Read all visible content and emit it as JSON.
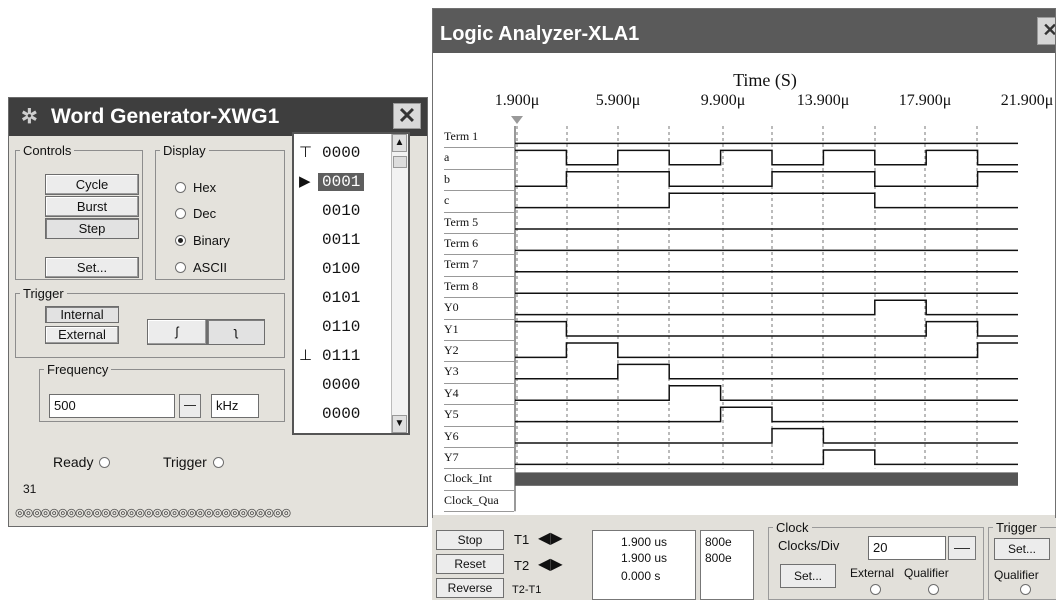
{
  "word_generator": {
    "title": "Word Generator-XWG1",
    "close": "✕",
    "controls": {
      "legend": "Controls",
      "cycle": "Cycle",
      "burst": "Burst",
      "step": "Step",
      "set": "Set..."
    },
    "display": {
      "legend": "Display",
      "options": [
        "Hex",
        "Dec",
        "Binary",
        "ASCII"
      ],
      "selected": "Binary"
    },
    "trigger": {
      "legend": "Trigger",
      "internal": "Internal",
      "external": "External",
      "rising_edge": "ʃ",
      "falling_edge": "ʅ"
    },
    "frequency": {
      "legend": "Frequency",
      "value": "500",
      "unit": "kHz"
    },
    "status": {
      "ready": "Ready",
      "trigger": "Trigger"
    },
    "counter": "31",
    "words": [
      {
        "mark": "⊤",
        "value": "0000"
      },
      {
        "mark": "▶",
        "value": "0001",
        "selected": true
      },
      {
        "mark": "",
        "value": "0010"
      },
      {
        "mark": "",
        "value": "0011"
      },
      {
        "mark": "",
        "value": "0100"
      },
      {
        "mark": "",
        "value": "0101"
      },
      {
        "mark": "",
        "value": "0110"
      },
      {
        "mark": "⊥",
        "value": "0111"
      },
      {
        "mark": "",
        "value": "0000"
      },
      {
        "mark": "",
        "value": "0000"
      }
    ],
    "pin_dots": "◎◎◎◎◎◎◎◎◎◎◎◎◎◎◎◎◎◎◎◎◎◎◎◎◎◎◎◎◎◎◎◎"
  },
  "logic_analyzer": {
    "title": "Logic Analyzer-XLA1",
    "close": "✕",
    "time_label": "Time (S)",
    "time_ticks": [
      "1.900μ",
      "5.900μ",
      "9.900μ",
      "13.900μ",
      "17.900μ",
      "21.900μ"
    ],
    "channels": [
      "Term 1",
      "a",
      "b",
      "c",
      "Term 5",
      "Term 6",
      "Term 7",
      "Term 8",
      "Y0",
      "Y1",
      "Y2",
      "Y3",
      "Y4",
      "Y5",
      "Y6",
      "Y7",
      "Clock_Int",
      "Clock_Qua"
    ],
    "controls": {
      "stop": "Stop",
      "reset": "Reset",
      "reverse": "Reverse",
      "t1_label": "T1",
      "t2_label": "T2",
      "t2t1_label": "T2-T1",
      "t1_time": "1.900 us",
      "t2_time": "1.900 us",
      "diff_time": "0.000 s",
      "t1_value": "800e",
      "t2_value": "800e"
    },
    "clock": {
      "legend": "Clock",
      "clocks_per_div_label": "Clocks/Div",
      "clocks_per_div_value": "20",
      "set": "Set...",
      "external": "External",
      "qualifier": "Qualifier"
    },
    "trigger": {
      "legend": "Trigger",
      "set": "Set...",
      "qualifier": "Qualifier"
    }
  }
}
